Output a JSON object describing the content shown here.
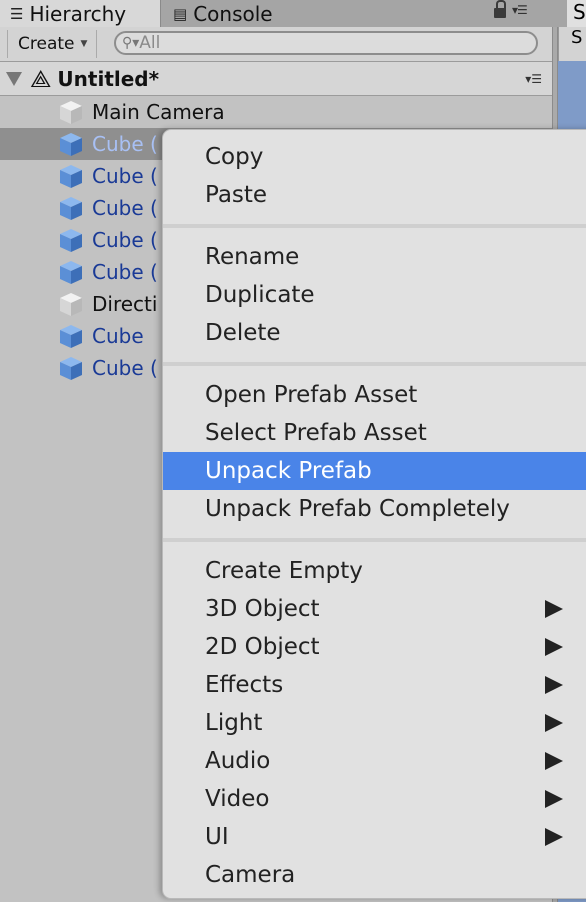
{
  "tabs": {
    "hierarchy": {
      "label": "Hierarchy",
      "icon": "list-icon"
    },
    "console": {
      "label": "Console",
      "icon": "console-icon"
    },
    "scene_partial": "S"
  },
  "toolbar": {
    "create_label": "Create",
    "search_placeholder": "All",
    "scene_toolbar_partial": "S"
  },
  "scene": {
    "name": "Untitled*"
  },
  "hierarchy_items": [
    {
      "label": "Main Camera",
      "icon": "gameobject-icon",
      "prefab": false,
      "selected": false
    },
    {
      "label": "Cube (",
      "icon": "prefab-cube-icon",
      "prefab": true,
      "selected": true
    },
    {
      "label": "Cube (",
      "icon": "prefab-cube-icon",
      "prefab": true,
      "selected": false
    },
    {
      "label": "Cube (",
      "icon": "prefab-cube-icon",
      "prefab": true,
      "selected": false
    },
    {
      "label": "Cube (",
      "icon": "prefab-cube-icon",
      "prefab": true,
      "selected": false
    },
    {
      "label": "Cube (",
      "icon": "prefab-cube-icon",
      "prefab": true,
      "selected": false
    },
    {
      "label": "Directi",
      "icon": "gameobject-icon",
      "prefab": false,
      "selected": false
    },
    {
      "label": "Cube",
      "icon": "prefab-cube-icon",
      "prefab": true,
      "selected": false
    },
    {
      "label": "Cube (",
      "icon": "prefab-cube-icon",
      "prefab": true,
      "selected": false
    }
  ],
  "context_menu": {
    "groups": [
      [
        {
          "label": "Copy"
        },
        {
          "label": "Paste"
        }
      ],
      [
        {
          "label": "Rename"
        },
        {
          "label": "Duplicate"
        },
        {
          "label": "Delete"
        }
      ],
      [
        {
          "label": "Open Prefab Asset"
        },
        {
          "label": "Select Prefab Asset"
        },
        {
          "label": "Unpack Prefab",
          "highlighted": true
        },
        {
          "label": "Unpack Prefab Completely"
        }
      ],
      [
        {
          "label": "Create Empty"
        },
        {
          "label": "3D Object",
          "submenu": true
        },
        {
          "label": "2D Object",
          "submenu": true
        },
        {
          "label": "Effects",
          "submenu": true
        },
        {
          "label": "Light",
          "submenu": true
        },
        {
          "label": "Audio",
          "submenu": true
        },
        {
          "label": "Video",
          "submenu": true
        },
        {
          "label": "UI",
          "submenu": true
        },
        {
          "label": "Camera"
        }
      ]
    ]
  },
  "colors": {
    "highlight": "#4a84e8",
    "prefab_text": "#1a3a96",
    "selected_text": "#a8c0f4"
  }
}
